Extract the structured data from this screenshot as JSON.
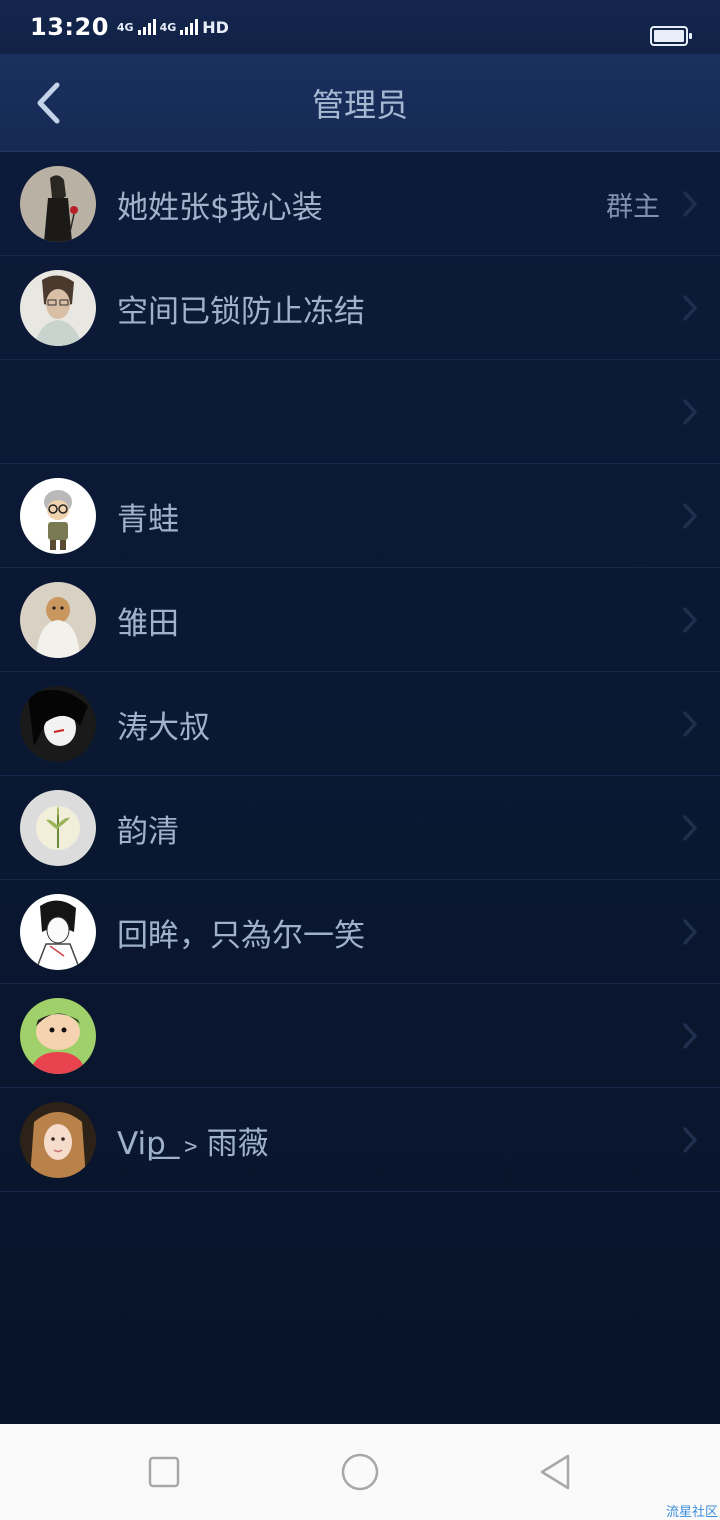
{
  "status_bar": {
    "time": "13:20",
    "network_1": "4G",
    "network_2": "4G",
    "hd_label": "HD"
  },
  "header": {
    "title": "管理员"
  },
  "members": [
    {
      "name": "她姓张$我心装",
      "role": "群主",
      "avatar_icon": "avatar-sketch-rose-icon"
    },
    {
      "name": "空间已锁防止冻结",
      "role": "",
      "avatar_icon": "avatar-man-glasses-icon"
    },
    {
      "name": "",
      "role": "",
      "avatar_icon": ""
    },
    {
      "name": "青蛙",
      "role": "",
      "avatar_icon": "avatar-cartoon-grandma-icon"
    },
    {
      "name": "雏田",
      "role": "",
      "avatar_icon": "avatar-dog-blanket-icon"
    },
    {
      "name": "涛大叔",
      "role": "",
      "avatar_icon": "avatar-anime-dark-hair-icon"
    },
    {
      "name": "韵清",
      "role": "",
      "avatar_icon": "avatar-leaf-icon"
    },
    {
      "name": "回眸，只為尔一笑",
      "role": "",
      "avatar_icon": "avatar-anime-sketch-icon"
    },
    {
      "name": "",
      "role": "",
      "avatar_icon": "avatar-cartoon-boy-icon"
    },
    {
      "name": "Vip͟ ﹥雨薇",
      "role": "",
      "avatar_icon": "avatar-girl-photo-icon"
    }
  ],
  "system_nav": {
    "recents": "recents-square-icon",
    "home": "home-circle-icon",
    "back": "back-triangle-icon"
  },
  "watermark": "流星社区",
  "colors": {
    "background": "#0b1832",
    "header": "#152953",
    "text": "#9fb1cb",
    "divider": "#16284a"
  }
}
